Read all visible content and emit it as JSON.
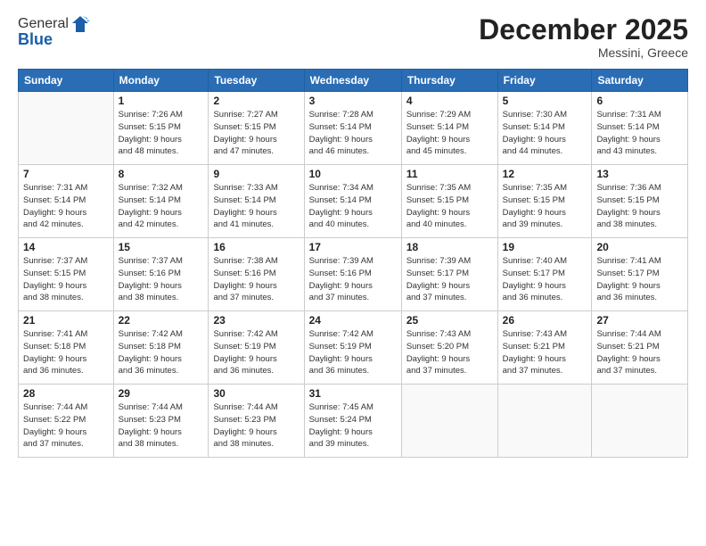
{
  "logo": {
    "line1": "General",
    "line2": "Blue"
  },
  "title": "December 2025",
  "subtitle": "Messini, Greece",
  "days_header": [
    "Sunday",
    "Monday",
    "Tuesday",
    "Wednesday",
    "Thursday",
    "Friday",
    "Saturday"
  ],
  "weeks": [
    [
      {
        "day": "",
        "info": ""
      },
      {
        "day": "1",
        "info": "Sunrise: 7:26 AM\nSunset: 5:15 PM\nDaylight: 9 hours\nand 48 minutes."
      },
      {
        "day": "2",
        "info": "Sunrise: 7:27 AM\nSunset: 5:15 PM\nDaylight: 9 hours\nand 47 minutes."
      },
      {
        "day": "3",
        "info": "Sunrise: 7:28 AM\nSunset: 5:14 PM\nDaylight: 9 hours\nand 46 minutes."
      },
      {
        "day": "4",
        "info": "Sunrise: 7:29 AM\nSunset: 5:14 PM\nDaylight: 9 hours\nand 45 minutes."
      },
      {
        "day": "5",
        "info": "Sunrise: 7:30 AM\nSunset: 5:14 PM\nDaylight: 9 hours\nand 44 minutes."
      },
      {
        "day": "6",
        "info": "Sunrise: 7:31 AM\nSunset: 5:14 PM\nDaylight: 9 hours\nand 43 minutes."
      }
    ],
    [
      {
        "day": "7",
        "info": "Sunrise: 7:31 AM\nSunset: 5:14 PM\nDaylight: 9 hours\nand 42 minutes."
      },
      {
        "day": "8",
        "info": "Sunrise: 7:32 AM\nSunset: 5:14 PM\nDaylight: 9 hours\nand 42 minutes."
      },
      {
        "day": "9",
        "info": "Sunrise: 7:33 AM\nSunset: 5:14 PM\nDaylight: 9 hours\nand 41 minutes."
      },
      {
        "day": "10",
        "info": "Sunrise: 7:34 AM\nSunset: 5:14 PM\nDaylight: 9 hours\nand 40 minutes."
      },
      {
        "day": "11",
        "info": "Sunrise: 7:35 AM\nSunset: 5:15 PM\nDaylight: 9 hours\nand 40 minutes."
      },
      {
        "day": "12",
        "info": "Sunrise: 7:35 AM\nSunset: 5:15 PM\nDaylight: 9 hours\nand 39 minutes."
      },
      {
        "day": "13",
        "info": "Sunrise: 7:36 AM\nSunset: 5:15 PM\nDaylight: 9 hours\nand 38 minutes."
      }
    ],
    [
      {
        "day": "14",
        "info": "Sunrise: 7:37 AM\nSunset: 5:15 PM\nDaylight: 9 hours\nand 38 minutes."
      },
      {
        "day": "15",
        "info": "Sunrise: 7:37 AM\nSunset: 5:16 PM\nDaylight: 9 hours\nand 38 minutes."
      },
      {
        "day": "16",
        "info": "Sunrise: 7:38 AM\nSunset: 5:16 PM\nDaylight: 9 hours\nand 37 minutes."
      },
      {
        "day": "17",
        "info": "Sunrise: 7:39 AM\nSunset: 5:16 PM\nDaylight: 9 hours\nand 37 minutes."
      },
      {
        "day": "18",
        "info": "Sunrise: 7:39 AM\nSunset: 5:17 PM\nDaylight: 9 hours\nand 37 minutes."
      },
      {
        "day": "19",
        "info": "Sunrise: 7:40 AM\nSunset: 5:17 PM\nDaylight: 9 hours\nand 36 minutes."
      },
      {
        "day": "20",
        "info": "Sunrise: 7:41 AM\nSunset: 5:17 PM\nDaylight: 9 hours\nand 36 minutes."
      }
    ],
    [
      {
        "day": "21",
        "info": "Sunrise: 7:41 AM\nSunset: 5:18 PM\nDaylight: 9 hours\nand 36 minutes."
      },
      {
        "day": "22",
        "info": "Sunrise: 7:42 AM\nSunset: 5:18 PM\nDaylight: 9 hours\nand 36 minutes."
      },
      {
        "day": "23",
        "info": "Sunrise: 7:42 AM\nSunset: 5:19 PM\nDaylight: 9 hours\nand 36 minutes."
      },
      {
        "day": "24",
        "info": "Sunrise: 7:42 AM\nSunset: 5:19 PM\nDaylight: 9 hours\nand 36 minutes."
      },
      {
        "day": "25",
        "info": "Sunrise: 7:43 AM\nSunset: 5:20 PM\nDaylight: 9 hours\nand 37 minutes."
      },
      {
        "day": "26",
        "info": "Sunrise: 7:43 AM\nSunset: 5:21 PM\nDaylight: 9 hours\nand 37 minutes."
      },
      {
        "day": "27",
        "info": "Sunrise: 7:44 AM\nSunset: 5:21 PM\nDaylight: 9 hours\nand 37 minutes."
      }
    ],
    [
      {
        "day": "28",
        "info": "Sunrise: 7:44 AM\nSunset: 5:22 PM\nDaylight: 9 hours\nand 37 minutes."
      },
      {
        "day": "29",
        "info": "Sunrise: 7:44 AM\nSunset: 5:23 PM\nDaylight: 9 hours\nand 38 minutes."
      },
      {
        "day": "30",
        "info": "Sunrise: 7:44 AM\nSunset: 5:23 PM\nDaylight: 9 hours\nand 38 minutes."
      },
      {
        "day": "31",
        "info": "Sunrise: 7:45 AM\nSunset: 5:24 PM\nDaylight: 9 hours\nand 39 minutes."
      },
      {
        "day": "",
        "info": ""
      },
      {
        "day": "",
        "info": ""
      },
      {
        "day": "",
        "info": ""
      }
    ]
  ]
}
